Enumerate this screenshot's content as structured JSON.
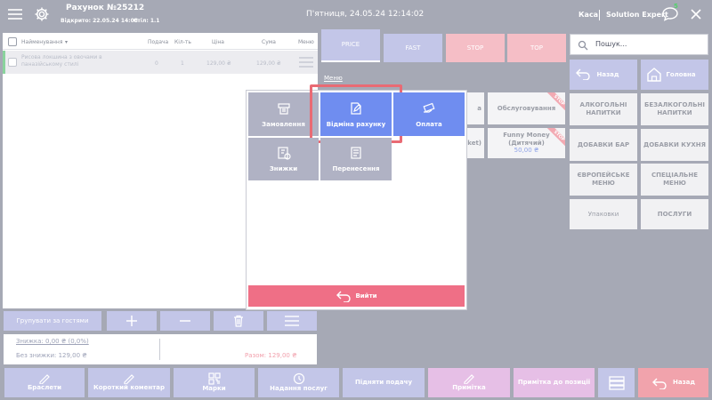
{
  "header": {
    "title": "Рахунок №25212",
    "opened_label": "Відкрито: 22.05.24 14:08",
    "table_label": "Стіл: 1.1",
    "datetime": "П'ятниця, 24.05.24 12:14:02",
    "register": "Каса",
    "user": "Solution Expert",
    "notif_count": "5"
  },
  "order_table": {
    "columns": [
      "Найменування",
      "Подача",
      "Кіл-ть",
      "Ціна",
      "Сума",
      "Меню"
    ],
    "rows": [
      {
        "name": "Рисова локшина з овочами в паназійському стилі",
        "serve": "0",
        "qty": "1",
        "price": "129,00 ₴",
        "sum": "129,00 ₴"
      }
    ]
  },
  "bottom_actions": {
    "group_label": "Групувати за гостями"
  },
  "totals": {
    "discount": "Знижка: 0,00 ₴ (0,0%)",
    "without_discount": "Без знижки: 129,00 ₴",
    "total": "Разом: 129,00 ₴"
  },
  "top_tabs": [
    "PRICE",
    "FAST",
    "STOP",
    "TOP"
  ],
  "menu_link": "Меню",
  "products": {
    "item_a": "Обслуговування",
    "item_b_name": "Funny Money (Дитячий)",
    "item_b_price": "50,00 ₴",
    "badge": "STOP",
    "cut_a": "а",
    "cut_b": "ket)"
  },
  "search": {
    "placeholder": "Пошук..."
  },
  "nav": {
    "back": "Назад",
    "home": "Головна"
  },
  "categories": [
    "АЛКОГОЛЬНІ НАПИТКИ",
    "БЕЗАЛКОГОЛЬНІ НАПИТКИ",
    "ДОБАВКИ БАР",
    "ДОБАВКИ КУХНЯ",
    "ЄВРОПЕЙСЬКЕ МЕНЮ",
    "СПЕЦІАЛЬНЕ МЕНЮ",
    "Упаковки",
    "ПОСЛУГИ"
  ],
  "modal": {
    "tiles": [
      "Замовлення",
      "Відміна рахунку",
      "Оплата",
      "Знижки",
      "Перенесення"
    ],
    "exit": "Вийти"
  },
  "footer": [
    "Браслети",
    "Короткий коментар",
    "Марки",
    "Надання послуг",
    "Підняти подачу",
    "Примітка",
    "Примітка до позиції",
    "Назад"
  ],
  "colors": {
    "accent_blue": "#6f8df0",
    "highlight": "#e96a74",
    "exit_pink": "#ef6f86"
  }
}
